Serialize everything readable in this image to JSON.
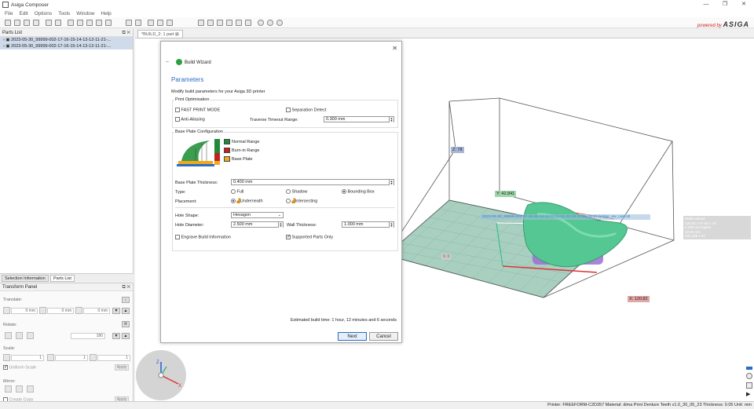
{
  "app": {
    "title": "Asiga Composer",
    "brand_prefix": "powered by",
    "brand_name": "ASIGA"
  },
  "window_controls": {
    "minimize": "—",
    "maximize": "❐",
    "close": "✕"
  },
  "menu": [
    "File",
    "Edit",
    "Options",
    "Tools",
    "Window",
    "Help"
  ],
  "parts_panel": {
    "title": "Parts List",
    "rows": [
      "2023-05-30_99999-002-17-16-15-14-13-12-11-21-...",
      "2023-05-30_99999-002-17-16-15-14-13-12-11-21-..."
    ],
    "tabs": [
      "Selection Information",
      "Parts List"
    ]
  },
  "transform": {
    "title": "Transform Panel",
    "translate_label": "Translate:",
    "translate_values": [
      "0 mm",
      "0 mm",
      "0 mm"
    ],
    "rotate_label": "Rotate:",
    "rotate_value": "180",
    "scale_label": "Scale:",
    "scale_values": [
      "1",
      "1",
      "1"
    ],
    "uniform_scale": "Uniform Scale",
    "apply": "Apply",
    "mirror_label": "Mirror:",
    "create_copy": "Create Copy"
  },
  "doc_tab": "*BUILD_2: 1 part",
  "dialog": {
    "wizard_title": "Build Wizard",
    "heading": "Parameters",
    "intro": "Modify build parameters for your Asiga 3D printer",
    "print_opt": "Print Optimisation",
    "fast_print": "FAST PRINT MODE",
    "separation": "Separation Detect",
    "anti_alias": "Anti-Aliasing",
    "traverse_label": "Traverse Timeout Range:",
    "traverse_value": "0.300 mm",
    "base_plate_cfg": "Base Plate Configuration",
    "legend": [
      {
        "label": "Normal Range",
        "color": "#1e8a3a"
      },
      {
        "label": "Burn-in Range",
        "color": "#c0221e"
      },
      {
        "label": "Base Plate",
        "color": "#f1a81d"
      }
    ],
    "bp_thickness_label": "Base Plate Thickness:",
    "bp_thickness_value": "0.400 mm",
    "type_label": "Type:",
    "type_options": [
      "Full",
      "Shadow",
      "Bounding Box"
    ],
    "placement_label": "Placement:",
    "placement_options": [
      "Underneath",
      "Intersecting"
    ],
    "hole_shape_label": "Hole Shape:",
    "hole_shape_value": "Hexagon",
    "hole_diameter_label": "Hole Diameter:",
    "hole_diameter_value": "2.500 mm",
    "wall_label": "Wall Thickness:",
    "wall_value": "1.000 mm",
    "engrave": "Engrave Build Information",
    "supported_only": "Supported Parts Only",
    "estimate": "Estimated build time: 1 hour, 12 minutes and 6 seconds",
    "next": "Next",
    "cancel": "Cancel"
  },
  "viewport": {
    "z_label": "Z: 78",
    "y_label": "Y: 42.841",
    "x_label": "X: 120.82",
    "origin_label": "0, 0",
    "part_label": "2023-05-30_99999-002-17-16-15-14-13-12-11-21-22-23-24-25-26-27-bridge_ew_cast.stl",
    "side_info": [
      "Build volume",
      "120.82 x 67.68 x 78",
      "0.300 mm layers",
      "10.05 mm",
      "102.298 x 67"
    ]
  },
  "status": "Printer: FREEFORM-C2D357  Material: dima Print Denture Teeth v1.0_30_05_23  Thickness: 0.05  Unit: mm"
}
